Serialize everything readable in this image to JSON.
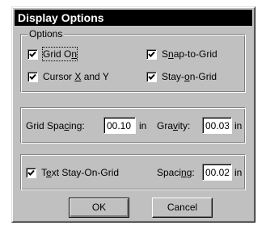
{
  "window": {
    "title": "Display Options"
  },
  "options_group": {
    "legend": "Options",
    "grid_on": {
      "label_pre": "Grid O",
      "label_ul": "n",
      "label_post": "",
      "checked": true
    },
    "snap_to_grid": {
      "label_pre": "S",
      "label_ul": "n",
      "label_post": "ap-to-Grid",
      "checked": true
    },
    "cursor_xy": {
      "label_pre": "Cursor ",
      "label_ul": "X",
      "label_post": " and Y",
      "checked": true
    },
    "stay_on_grid": {
      "label_pre": "Stay-",
      "label_ul": "o",
      "label_post": "n-Grid",
      "checked": true
    }
  },
  "spacing_group": {
    "grid_spacing": {
      "label_pre": "Grid Spa",
      "label_ul": "c",
      "label_post": "ing:",
      "value": "00.10",
      "unit": "in"
    },
    "gravity": {
      "label_pre": "Gra",
      "label_ul": "v",
      "label_post": "ity:",
      "value": "00.03",
      "unit": "in"
    }
  },
  "text_group": {
    "text_stay_on_grid": {
      "label_pre": "T",
      "label_ul": "e",
      "label_post": "xt Stay-On-Grid",
      "checked": true
    },
    "spacing": {
      "label_pre": "Spaci",
      "label_ul": "n",
      "label_post": "g:",
      "value": "00.02",
      "unit": "in"
    }
  },
  "buttons": {
    "ok": "OK",
    "cancel": "Cancel"
  }
}
